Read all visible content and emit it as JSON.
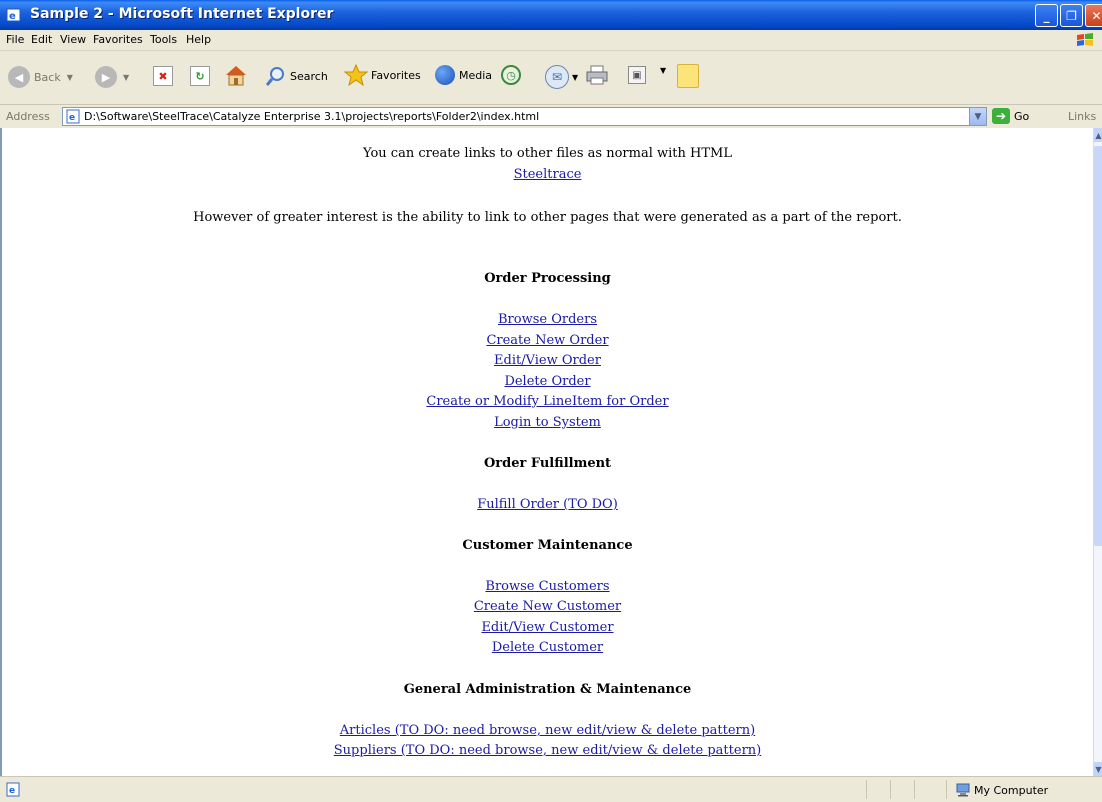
{
  "window": {
    "title": "Sample 2 - Microsoft Internet Explorer"
  },
  "menu": [
    "File",
    "Edit",
    "View",
    "Favorites",
    "Tools",
    "Help"
  ],
  "toolbar": {
    "back_label": "Back",
    "search_label": "Search",
    "favorites_label": "Favorites",
    "media_label": "Media"
  },
  "address": {
    "label": "Address",
    "value": "D:\\Software\\SteelTrace\\Catalyze Enterprise 3.1\\projects\\reports\\Folder2\\index.html",
    "go_label": "Go",
    "links_label": "Links"
  },
  "page": {
    "intro": "You can create links to other files as normal with HTML",
    "steeltrace_link": "Steeltrace",
    "interest": "However of greater interest is the ability to link to other pages that were generated as a part of the report.",
    "sections": [
      {
        "heading": "Order Processing",
        "links": [
          "Browse Orders",
          "Create New Order",
          "Edit/View Order",
          "Delete Order",
          "Create or Modify LineItem for Order",
          "Login to System"
        ]
      },
      {
        "heading": "Order Fulfillment",
        "links": [
          "Fulfill Order (TO DO)"
        ]
      },
      {
        "heading": "Customer Maintenance",
        "links": [
          "Browse Customers",
          "Create New Customer",
          "Edit/View Customer",
          "Delete Customer"
        ]
      },
      {
        "heading": "General Administration & Maintenance",
        "links": [
          "Articles (TO DO: need browse, new edit/view & delete pattern)",
          "Suppliers (TO DO: need browse, new edit/view & delete pattern)"
        ]
      }
    ]
  },
  "status": {
    "zone": "My Computer"
  }
}
